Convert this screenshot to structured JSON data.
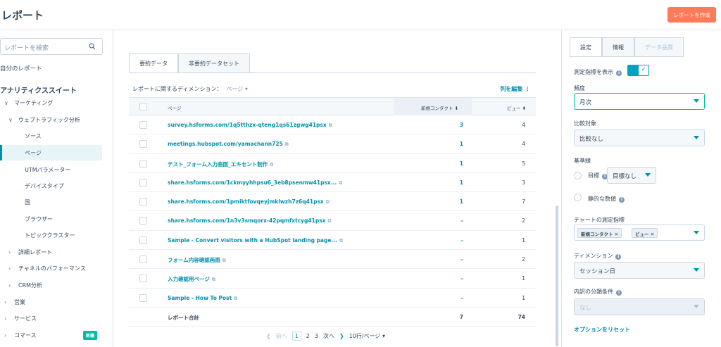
{
  "header": {
    "title": "レポート",
    "create_label": "レポートを作成"
  },
  "sidebar": {
    "search_placeholder": "レポートを検索",
    "my_reports": "自分のレポート",
    "section_title": "アナリティクススイート",
    "items": [
      {
        "label": "マーケティング",
        "chev": "∨"
      },
      {
        "label": "ウェブトラフィック分析",
        "chev": "∨"
      },
      {
        "label": "ソース"
      },
      {
        "label": "ページ"
      },
      {
        "label": "UTMパラメーター"
      },
      {
        "label": "デバイスタイプ"
      },
      {
        "label": "国"
      },
      {
        "label": "ブラウザー"
      },
      {
        "label": "トピッククラスター"
      },
      {
        "label": "詳細レポート",
        "chev": "›"
      },
      {
        "label": "チャネルのパフォーマンス",
        "chev": "›"
      },
      {
        "label": "CRM分析",
        "chev": "›"
      },
      {
        "label": "営業",
        "chev": "›"
      },
      {
        "label": "サービス",
        "chev": "›"
      },
      {
        "label": "コマース",
        "chev": "›"
      }
    ],
    "new_badge": "新機"
  },
  "main": {
    "tabs": [
      "要約データ",
      "非要約データセット"
    ],
    "dimension_label": "レポートに関するディメンション：",
    "dimension_value": "ページ ▾",
    "edit_columns": "列を編集 ⋮",
    "columns": {
      "page": "ページ",
      "contacts": "新規コンタクト ⬇",
      "views": "ビュー ⬍"
    },
    "rows": [
      {
        "page": "survey.hsforms.com/1q5tthzx-qteng1qs61zgwg41psx",
        "contacts": "3",
        "views": "4"
      },
      {
        "page": "meetings.hubspot.com/yamachann725",
        "contacts": "1",
        "views": "4"
      },
      {
        "page": "テスト_フォーム入力画面_エキセント制作",
        "contacts": "1",
        "views": "5"
      },
      {
        "page": "share.hsforms.com/1ckmyyhhpsu6_3eb8psenmw41psx...",
        "contacts": "1",
        "views": "3"
      },
      {
        "page": "share.hsforms.com/1pmiktfovqeyjmklwzh7z6q41psx",
        "contacts": "1",
        "views": "7"
      },
      {
        "page": "share.hsforms.com/1n3v3smqorx-42pqmfxtcyg41psx",
        "contacts": "–",
        "views": "2"
      },
      {
        "page": "Sample - Convert visitors with a HubSpot landing page...",
        "contacts": "–",
        "views": "1"
      },
      {
        "page": "フォーム内容確認画面",
        "contacts": "–",
        "views": "2"
      },
      {
        "page": "入力確認用ページ",
        "contacts": "–",
        "views": "1"
      },
      {
        "page": "Sample - How To Post",
        "contacts": "–",
        "views": "1"
      }
    ],
    "total": {
      "label": "レポート合計",
      "contacts": "7",
      "views": "74"
    },
    "pager": {
      "prev": "前へ",
      "pages": [
        "1",
        "2",
        "3"
      ],
      "next": "次へ",
      "per_page": "10行/ページ ▾"
    }
  },
  "panel": {
    "tabs": [
      "設定",
      "情報",
      "データ品質"
    ],
    "show_metrics": "測定指標を表示",
    "frequency_label": "頻度",
    "frequency_value": "月次",
    "compare_label": "比較対象",
    "compare_value": "比較なし",
    "baseline_label": "基準線",
    "goal_label": "目標",
    "goal_value": "目標なし",
    "static_label": "静的な数値",
    "chart_metrics_label": "チャートの測定指標",
    "chips": [
      "新規コンタクト",
      "ビュー"
    ],
    "dimension_label": "ディメンション",
    "dimension_value": "セッション日",
    "breakdown_label": "内訳の分類条件",
    "breakdown_value": "なし",
    "reset": "オプションをリセット"
  },
  "colors": {
    "accent": "#0091ae",
    "cta": "#ff7a59",
    "toggle": "#00a4bd"
  }
}
